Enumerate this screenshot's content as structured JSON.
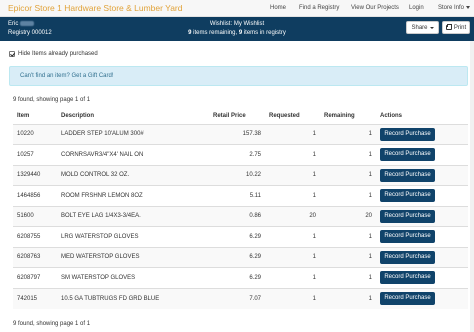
{
  "header": {
    "brand": "Epicor Store 1 Hardware Store & Lumber Yard",
    "nav": {
      "home": "Home",
      "find_registry": "Find a Registry",
      "view_projects": "View Our Projects",
      "login": "Login",
      "store_info": "Store Info"
    }
  },
  "registry_bar": {
    "user_name": "Eric",
    "registry_id": "Registry 000012",
    "wishlist_label": "Wishlist:",
    "wishlist_name": "My Wishlist",
    "items_remaining_count": "9",
    "items_remaining_text": " items remaining, ",
    "items_in_registry_count": "9",
    "items_in_registry_text": " items in registry",
    "share_label": "Share",
    "print_label": "Print"
  },
  "filters": {
    "hide_purchased_label": "Hide Items already purchased",
    "hide_purchased_checked": true
  },
  "notice": {
    "text": "Can't find an item? Get a Gift Card!"
  },
  "pagination": {
    "summary": "9 found, showing page 1 of 1"
  },
  "table": {
    "columns": [
      "Item",
      "Description",
      "Retail Price",
      "Requested",
      "Remaining",
      "Actions"
    ],
    "action_label": "Record Purchase",
    "rows": [
      {
        "item": "10220",
        "description": "LADDER STEP 10'ALUM 300#",
        "price": "157.38",
        "requested": "1",
        "remaining": "1"
      },
      {
        "item": "10257",
        "description": "CORNRSAVR3/4\"X4' NAIL ON",
        "price": "2.75",
        "requested": "1",
        "remaining": "1"
      },
      {
        "item": "1329440",
        "description": "MOLD CONTROL 32 OZ.",
        "price": "10.22",
        "requested": "1",
        "remaining": "1"
      },
      {
        "item": "1464856",
        "description": "ROOM FRSHNR LEMON 8OZ",
        "price": "5.11",
        "requested": "1",
        "remaining": "1"
      },
      {
        "item": "51600",
        "description": "BOLT EYE LAG 1/4X3-3/4EA.",
        "price": "0.86",
        "requested": "20",
        "remaining": "20"
      },
      {
        "item": "6208755",
        "description": "LRG WATERSTOP GLOVES",
        "price": "6.29",
        "requested": "1",
        "remaining": "1"
      },
      {
        "item": "6208763",
        "description": "MED WATERSTOP GLOVES",
        "price": "6.29",
        "requested": "1",
        "remaining": "1"
      },
      {
        "item": "6208797",
        "description": "SM WATERSTOP GLOVES",
        "price": "6.29",
        "requested": "1",
        "remaining": "1"
      },
      {
        "item": "742015",
        "description": "10.5 GA TUBTRUGS FD GRD BLUE",
        "price": "7.07",
        "requested": "1",
        "remaining": "1"
      }
    ]
  },
  "colors": {
    "brand_orange": "#e1a33a",
    "registry_bar": "#0f3d60",
    "action_button": "#10436a",
    "notice_bg": "#d9edf7"
  }
}
